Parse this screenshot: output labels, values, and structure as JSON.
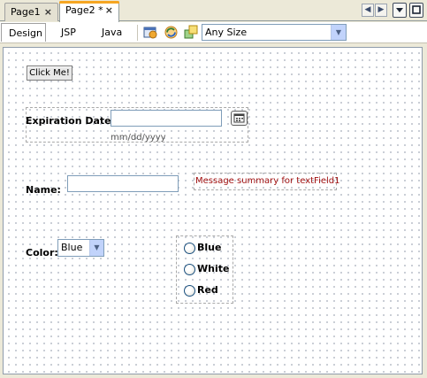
{
  "tabs": [
    {
      "label": "Page1"
    },
    {
      "label": "Page2 *"
    }
  ],
  "tab_close_glyph": "×",
  "nav": {
    "left_icon": "chevron-left-icon",
    "right_icon": "chevron-right-icon",
    "dropdown_icon": "chevron-down-icon",
    "maximize_icon": "maximize-icon"
  },
  "views": [
    {
      "label": "Design"
    },
    {
      "label": "JSP"
    },
    {
      "label": "Java"
    }
  ],
  "toolbar": {
    "icons": [
      "preview-in-browser-icon",
      "refresh-icon",
      "show-virtual-forms-icon"
    ],
    "size_select_value": "Any Size"
  },
  "form": {
    "button_label": "Click Me!",
    "expiration_label": "Expiration Date:",
    "expiration_hint": "mm/dd/yyyy",
    "calendar_icon": "calendar-icon",
    "name_label": "Name:",
    "message_text": "Message summary for textField1",
    "color_label": "Color:",
    "color_selected": "Blue",
    "radio_options": [
      "Blue",
      "White",
      "Red"
    ]
  },
  "colors": {
    "active_tab_accent": "#f6a623",
    "message_text": "#a01010",
    "input_border": "#7f9db9"
  }
}
